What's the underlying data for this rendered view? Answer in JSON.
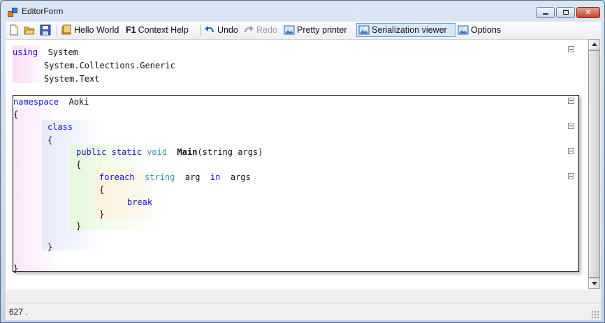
{
  "window": {
    "title": "EditorForm"
  },
  "toolbar": {
    "hello_world": "Hello World",
    "context_help_key": "F1",
    "context_help": "Context Help",
    "undo": "Undo",
    "redo": "Redo",
    "pretty_printer": "Pretty printer",
    "serialization_viewer": "Serialization viewer",
    "options": "Options"
  },
  "code": {
    "using_kw": "using",
    "using_1": "System",
    "using_2": "System.Collections.Generic",
    "using_3": "System.Text",
    "namespace_kw": "namespace",
    "namespace_name": "Aoki",
    "open_brace": "{",
    "close_brace": "}",
    "class_kw": "class",
    "public_kw": "public",
    "static_kw": "static",
    "void_kw": "void",
    "method_name": "Main",
    "method_params": "(string args)",
    "foreach_kw": "foreach",
    "string_kw": "string",
    "arg_var": "arg",
    "in_kw": "in",
    "args_var": "args",
    "break_kw": "break"
  },
  "status": {
    "text": "627 ."
  },
  "colors": {
    "keyword": "#1414d2",
    "type_keyword": "#3b93c3",
    "scope_using": "#fcdcf6",
    "scope_namespace": "#fde6fb",
    "scope_class": "#e5e9fb",
    "scope_method": "#e7f9da",
    "scope_foreach": "#fdf0dc",
    "selected_button": "#d8e8f8"
  }
}
